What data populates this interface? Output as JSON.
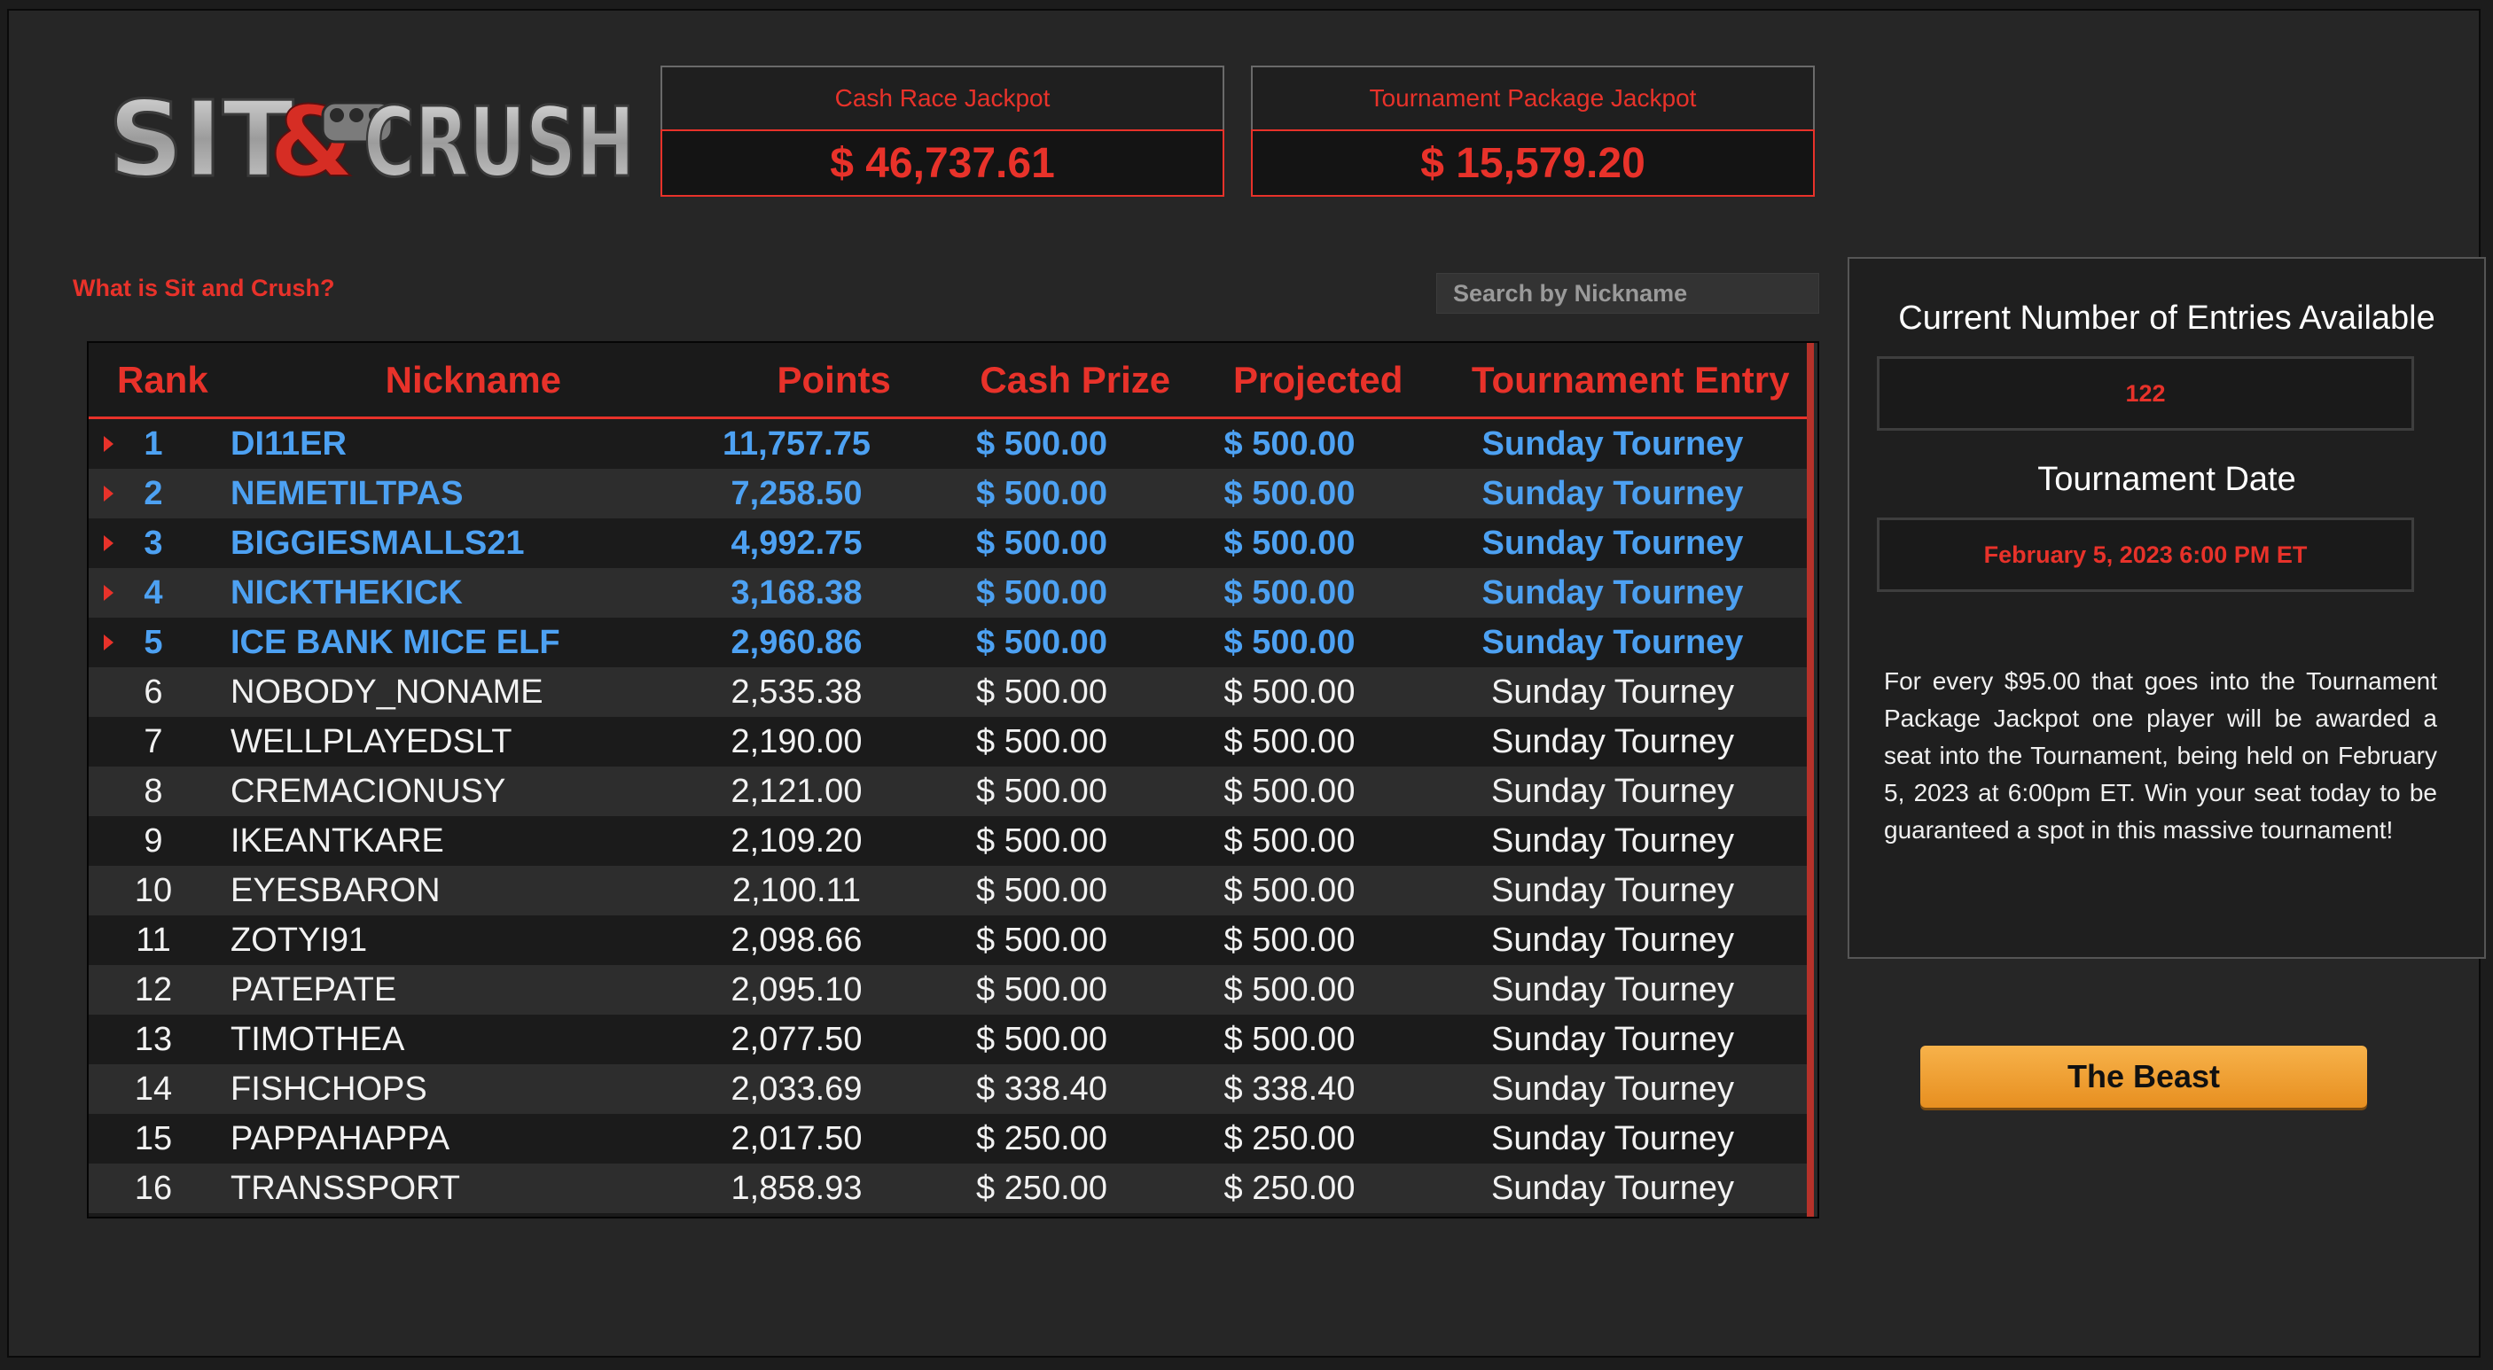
{
  "logo": {
    "text_left": "SIT",
    "text_amp": "&",
    "text_right": "CRUSH"
  },
  "jackpots": {
    "cash_race_label": "Cash Race Jackpot",
    "cash_race_value": "$ 46,737.61",
    "tournament_label": "Tournament Package Jackpot",
    "tournament_value": "$ 15,579.20"
  },
  "what_link": "What is Sit and Crush?",
  "search": {
    "placeholder": "Search by Nickname"
  },
  "table": {
    "headers": {
      "rank": "Rank",
      "nickname": "Nickname",
      "points": "Points",
      "cash_prize": "Cash Prize",
      "projected": "Projected",
      "tournament_entry": "Tournament Entry"
    },
    "rows": [
      {
        "rank": "1",
        "nickname": "DI11ER",
        "points": "11,757.75",
        "cash": "$ 500.00",
        "projected": "$ 500.00",
        "entry": "Sunday Tourney",
        "top": true
      },
      {
        "rank": "2",
        "nickname": "NEMETILTPAS",
        "points": "7,258.50",
        "cash": "$ 500.00",
        "projected": "$ 500.00",
        "entry": "Sunday Tourney",
        "top": true
      },
      {
        "rank": "3",
        "nickname": "BIGGIESMALLS21",
        "points": "4,992.75",
        "cash": "$ 500.00",
        "projected": "$ 500.00",
        "entry": "Sunday Tourney",
        "top": true
      },
      {
        "rank": "4",
        "nickname": "NICKTHEKICK",
        "points": "3,168.38",
        "cash": "$ 500.00",
        "projected": "$ 500.00",
        "entry": "Sunday Tourney",
        "top": true
      },
      {
        "rank": "5",
        "nickname": "ICE BANK MICE ELF",
        "points": "2,960.86",
        "cash": "$ 500.00",
        "projected": "$ 500.00",
        "entry": "Sunday Tourney",
        "top": true
      },
      {
        "rank": "6",
        "nickname": "NOBODY_NONAME",
        "points": "2,535.38",
        "cash": "$ 500.00",
        "projected": "$ 500.00",
        "entry": "Sunday Tourney",
        "top": false
      },
      {
        "rank": "7",
        "nickname": "WELLPLAYEDSLT",
        "points": "2,190.00",
        "cash": "$ 500.00",
        "projected": "$ 500.00",
        "entry": "Sunday Tourney",
        "top": false
      },
      {
        "rank": "8",
        "nickname": "CREMACIONUSY",
        "points": "2,121.00",
        "cash": "$ 500.00",
        "projected": "$ 500.00",
        "entry": "Sunday Tourney",
        "top": false
      },
      {
        "rank": "9",
        "nickname": "IKEANTKARE",
        "points": "2,109.20",
        "cash": "$ 500.00",
        "projected": "$ 500.00",
        "entry": "Sunday Tourney",
        "top": false
      },
      {
        "rank": "10",
        "nickname": "EYESBARON",
        "points": "2,100.11",
        "cash": "$ 500.00",
        "projected": "$ 500.00",
        "entry": "Sunday Tourney",
        "top": false
      },
      {
        "rank": "11",
        "nickname": "ZOTYI91",
        "points": "2,098.66",
        "cash": "$ 500.00",
        "projected": "$ 500.00",
        "entry": "Sunday Tourney",
        "top": false
      },
      {
        "rank": "12",
        "nickname": "PATEPATE",
        "points": "2,095.10",
        "cash": "$ 500.00",
        "projected": "$ 500.00",
        "entry": "Sunday Tourney",
        "top": false
      },
      {
        "rank": "13",
        "nickname": "TIMOTHEA",
        "points": "2,077.50",
        "cash": "$ 500.00",
        "projected": "$ 500.00",
        "entry": "Sunday Tourney",
        "top": false
      },
      {
        "rank": "14",
        "nickname": "FISHCHOPS",
        "points": "2,033.69",
        "cash": "$ 338.40",
        "projected": "$ 338.40",
        "entry": "Sunday Tourney",
        "top": false
      },
      {
        "rank": "15",
        "nickname": "PAPPAHAPPA",
        "points": "2,017.50",
        "cash": "$ 250.00",
        "projected": "$ 250.00",
        "entry": "Sunday Tourney",
        "top": false
      },
      {
        "rank": "16",
        "nickname": "TRANSSPORT",
        "points": "1,858.93",
        "cash": "$ 250.00",
        "projected": "$ 250.00",
        "entry": "Sunday Tourney",
        "top": false
      }
    ]
  },
  "panel": {
    "entries_title": "Current Number of Entries Available",
    "entries_value": "122",
    "date_title": "Tournament Date",
    "date_value": "February 5, 2023 6:00 PM ET",
    "description": "For every $95.00 that goes into the Tournament Package Jackpot one player will be awarded a seat into the Tournament, being held on February 5, 2023 at 6:00pm ET. Win your seat today to be guaranteed a spot in this massive tournament!"
  },
  "beast_button": "The Beast",
  "colors": {
    "accent_red": "#e8322a",
    "top_blue": "#4da1f2",
    "button_orange": "#f0a030",
    "background": "#262626"
  },
  "icons": {
    "row_arrow": "caret-right-icon"
  }
}
